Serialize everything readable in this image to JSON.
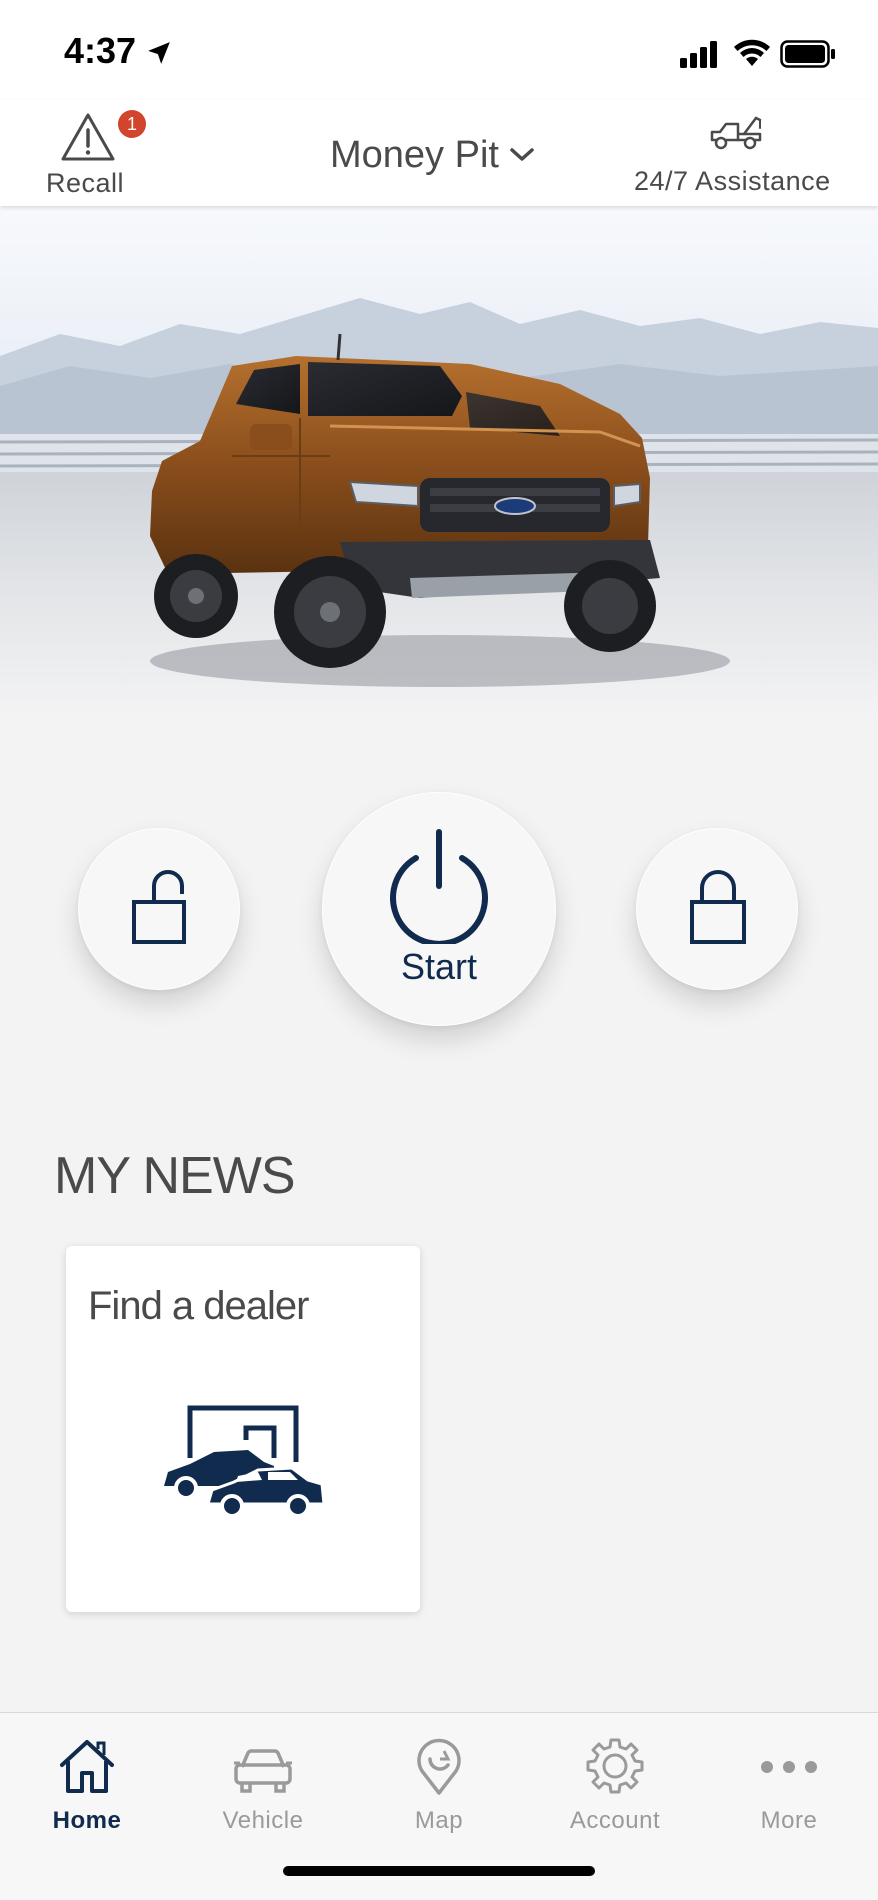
{
  "status_bar": {
    "time": "4:37"
  },
  "header": {
    "recall_label": "Recall",
    "recall_badge": "1",
    "vehicle_name": "Money Pit",
    "assistance_label": "24/7 Assistance"
  },
  "controls": {
    "start_label": "Start"
  },
  "news": {
    "section_title": "MY NEWS",
    "cards": [
      {
        "title": "Find a dealer"
      }
    ]
  },
  "bottom_nav": {
    "items": [
      {
        "label": "Home",
        "icon": "home-icon",
        "active": true
      },
      {
        "label": "Vehicle",
        "icon": "vehicle-icon",
        "active": false
      },
      {
        "label": "Map",
        "icon": "map-pin-icon",
        "active": false
      },
      {
        "label": "Account",
        "icon": "gear-icon",
        "active": false
      },
      {
        "label": "More",
        "icon": "more-icon",
        "active": false
      }
    ]
  },
  "colors": {
    "ford_navy": "#102b4e",
    "badge_red": "#d0452b",
    "truck_bronze": "#8a4e1c",
    "inactive_gray": "#9a9a9a"
  }
}
